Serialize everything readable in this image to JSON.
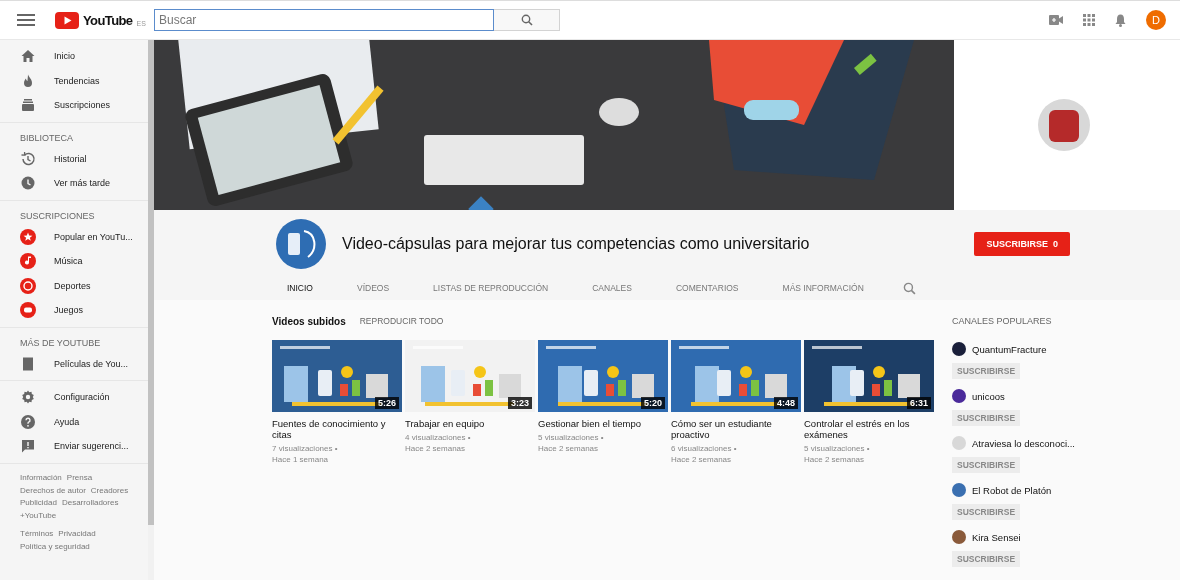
{
  "topbar": {
    "logo": "YouTube",
    "region": "ES",
    "search": {
      "placeholder": "Buscar"
    },
    "avatar": "D"
  },
  "sidebar": {
    "sections": [
      {
        "items": [
          {
            "kind": "nav",
            "label": "Inicio"
          },
          {
            "kind": "nav",
            "label": "Tendencias"
          },
          {
            "kind": "nav",
            "label": "Suscripciones"
          }
        ]
      },
      {
        "heading": "BIBLIOTECA",
        "items": [
          {
            "kind": "nav",
            "label": "Historial"
          },
          {
            "kind": "nav",
            "label": "Ver más tarde"
          }
        ]
      },
      {
        "heading": "SUSCRIPCIONES",
        "items": [
          {
            "kind": "channel",
            "label": "Popular en YouTu..."
          },
          {
            "kind": "channel",
            "label": "Música"
          },
          {
            "kind": "channel",
            "label": "Deportes"
          },
          {
            "kind": "channel",
            "label": "Juegos"
          }
        ]
      },
      {
        "heading": "MÁS DE YOUTUBE",
        "items": [
          {
            "kind": "nav",
            "label": "Películas de You..."
          }
        ]
      },
      {
        "items": [
          {
            "kind": "nav",
            "label": "Configuración"
          },
          {
            "kind": "nav",
            "label": "Ayuda"
          },
          {
            "kind": "nav",
            "label": "Enviar sugerenci..."
          }
        ]
      }
    ],
    "footer": [
      [
        [
          "Información",
          "Prensa"
        ],
        [
          "Derechos de autor",
          "Creadores"
        ],
        [
          "Publicidad",
          "Desarrolladores"
        ],
        [
          "+YouTube"
        ]
      ],
      [
        [
          "Términos",
          "Privacidad"
        ],
        [
          "Política y seguridad"
        ]
      ]
    ]
  },
  "channel": {
    "title": "Video-cápsulas para mejorar tus competencias como universitario",
    "subscribe": {
      "label": "SUSCRIBIRSE",
      "count": "0"
    },
    "tabs": [
      {
        "label": "INICIO",
        "selected": true
      },
      {
        "label": "VÍDEOS",
        "selected": false
      },
      {
        "label": "LISTAS DE REPRODUCCIÓN",
        "selected": false
      },
      {
        "label": "CANALES",
        "selected": false
      },
      {
        "label": "COMENTARIOS",
        "selected": false
      },
      {
        "label": "MÁS INFORMACIÓN",
        "selected": false
      }
    ]
  },
  "uploads": {
    "heading": "Videos subidos",
    "play_all": "REPRODUCIR TODO",
    "videos": [
      {
        "title": "Fuentes de conocimiento y citas",
        "views": "7 visualizaciones •",
        "age": "Hace 1 semana",
        "duration": "5:26"
      },
      {
        "title": "Trabajar en equipo",
        "views": "4 visualizaciones •",
        "age": "Hace 2 semanas",
        "duration": "3:23"
      },
      {
        "title": "Gestionar bien el tiempo",
        "views": "5 visualizaciones •",
        "age": "Hace 2 semanas",
        "duration": "5:20"
      },
      {
        "title": "Cómo ser un estudiante proactivo",
        "views": "6 visualizaciones •",
        "age": "Hace 2 semanas",
        "duration": "4:48"
      },
      {
        "title": "Controlar el estrés en los exámenes",
        "views": "5 visualizaciones •",
        "age": "Hace 2 semanas",
        "duration": "6:31"
      }
    ]
  },
  "popular": {
    "heading": "CANALES POPULARES",
    "channels": [
      {
        "name": "QuantumFracture",
        "button": "SUSCRIBIRSE",
        "color": "#1a1f3a"
      },
      {
        "name": "unicoos",
        "button": "SUSCRIBIRSE",
        "color": "#4a2a9a"
      },
      {
        "name": "Atraviesa lo desconoci...",
        "button": "SUSCRIBIRSE",
        "color": "#d8d8d8"
      },
      {
        "name": "El Robot de Platón",
        "button": "SUSCRIBIRSE",
        "color": "#3a6fb0"
      },
      {
        "name": "Kira Sensei",
        "button": "SUSCRIBIRSE",
        "color": "#8a5a3a"
      }
    ]
  }
}
